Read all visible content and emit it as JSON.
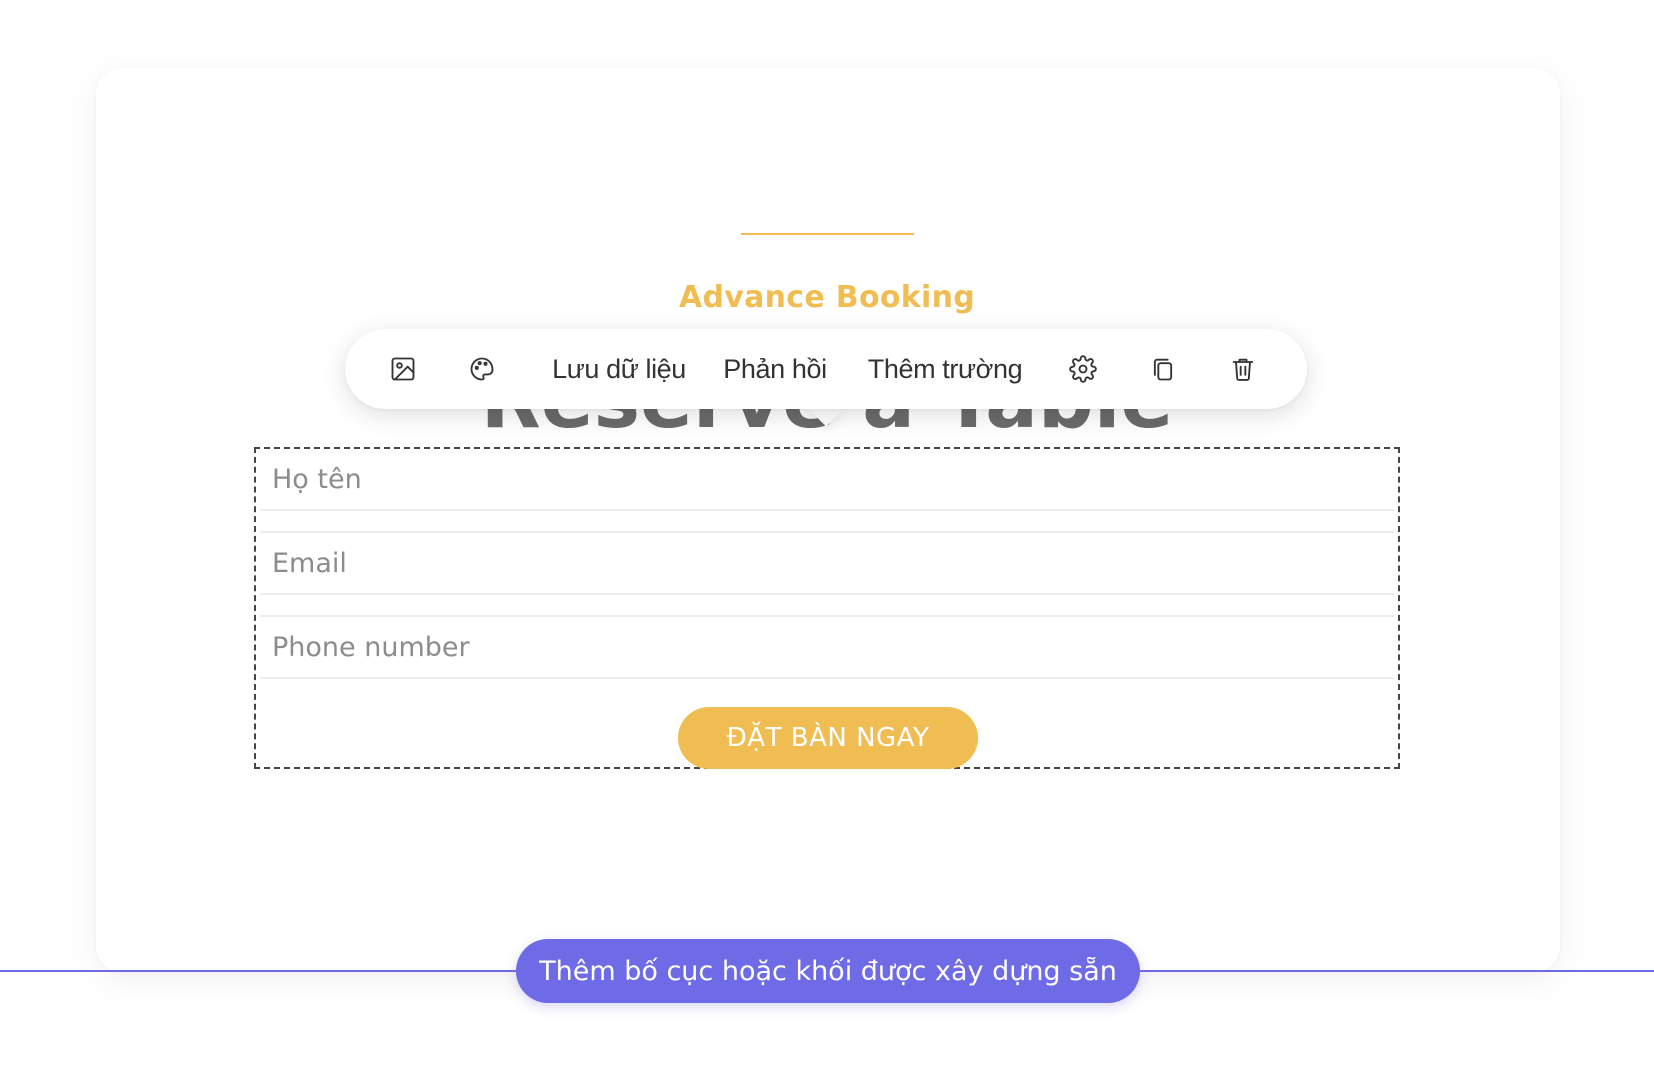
{
  "section": {
    "subtitle": "Advance Booking",
    "heading": "Reserve a Table"
  },
  "toolbar": {
    "items": [
      {
        "type": "icon",
        "icon": "image-icon"
      },
      {
        "type": "icon",
        "icon": "palette-icon"
      },
      {
        "type": "text",
        "label": "Lưu dữ liệu"
      },
      {
        "type": "text",
        "label": "Phản hồi"
      },
      {
        "type": "text",
        "label": "Thêm trường"
      },
      {
        "type": "icon",
        "icon": "gear-icon"
      },
      {
        "type": "icon",
        "icon": "copy-icon"
      },
      {
        "type": "icon",
        "icon": "trash-icon"
      }
    ]
  },
  "form": {
    "fields": [
      {
        "placeholder": "Họ tên"
      },
      {
        "placeholder": "Email"
      },
      {
        "placeholder": "Phone number"
      }
    ],
    "submit_label": "ĐẶT BÀN NGAY"
  },
  "add_block": {
    "label": "Thêm bố cục hoặc khối được xây dựng sẵn"
  },
  "colors": {
    "accent": "#f0bd52",
    "primary": "#6f6ae6",
    "heading": "#6b6b6b"
  }
}
